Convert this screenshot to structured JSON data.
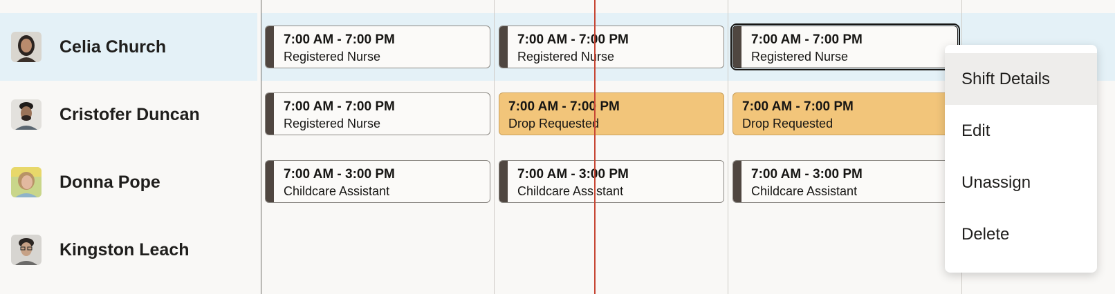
{
  "employees": [
    {
      "name": "Celia Church",
      "avatar": "avatar-celia",
      "selected": true
    },
    {
      "name": "Cristofer Duncan",
      "avatar": "avatar-cristofer",
      "selected": false
    },
    {
      "name": "Donna Pope",
      "avatar": "avatar-donna",
      "selected": false
    },
    {
      "name": "Kingston Leach",
      "avatar": "avatar-kingston",
      "selected": false
    }
  ],
  "shifts": {
    "celia": [
      {
        "time": "7:00 AM - 7:00 PM",
        "label": "Registered Nurse"
      },
      {
        "time": "7:00 AM - 7:00 PM",
        "label": "Registered Nurse"
      },
      {
        "time": "7:00 AM - 7:00 PM",
        "label": "Registered Nurse"
      }
    ],
    "cristofer": [
      {
        "time": "7:00 AM - 7:00 PM",
        "label": "Registered Nurse"
      },
      {
        "time": "7:00 AM - 7:00 PM",
        "label": "Drop Requested"
      },
      {
        "time": "7:00 AM - 7:00 PM",
        "label": "Drop Requested"
      }
    ],
    "donna": [
      {
        "time": "7:00 AM - 3:00 PM",
        "label": "Childcare Assistant"
      },
      {
        "time": "7:00 AM - 3:00 PM",
        "label": "Childcare Assistant"
      },
      {
        "time": "7:00 AM - 3:00 PM",
        "label": "Childcare Assistant"
      }
    ]
  },
  "context_menu": {
    "items": [
      "Shift Details",
      "Edit",
      "Unassign",
      "Delete"
    ],
    "active": "Shift Details"
  },
  "colors": {
    "selected_row": "#e4f1f7",
    "drop_requested": "#f2c57a",
    "current_time_line": "#c74634",
    "shift_bar": "#4f4640"
  }
}
